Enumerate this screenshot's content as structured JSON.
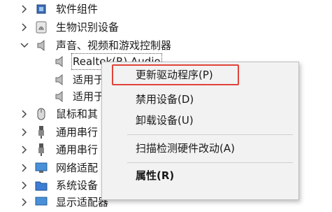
{
  "tree": [
    {
      "label": "软件组件",
      "icon": "chip-icon",
      "expanded": false
    },
    {
      "label": "生物识别设备",
      "icon": "fingerprint-icon",
      "expanded": false
    },
    {
      "label": "声音、视频和游戏控制器",
      "icon": "speaker-icon",
      "expanded": true
    },
    {
      "label": "Realtek(R) Audio",
      "icon": "speaker-icon",
      "child": true,
      "selected": true
    },
    {
      "label": "适用于",
      "icon": "speaker-icon",
      "child": true
    },
    {
      "label": "适用于",
      "icon": "speaker-icon",
      "child": true
    },
    {
      "label": "鼠标和其",
      "icon": "mouse-icon",
      "expanded": false
    },
    {
      "label": "通用串行",
      "icon": "usb-icon",
      "expanded": false
    },
    {
      "label": "通用串行",
      "icon": "usb-icon",
      "expanded": false
    },
    {
      "label": "网络适配",
      "icon": "monitor-network-icon",
      "expanded": false
    },
    {
      "label": "系统设备",
      "icon": "folder-icon",
      "expanded": false
    },
    {
      "label": "显示适配器",
      "icon": "monitor-icon",
      "expanded": false
    }
  ],
  "context_menu": {
    "items": [
      {
        "label": "更新驱动程序(P)",
        "bold": false
      },
      {
        "label": "禁用设备(D)",
        "bold": false
      },
      {
        "label": "卸载设备(U)",
        "bold": false
      },
      {
        "label": "扫描检测硬件改动(A)",
        "bold": false
      },
      {
        "label": "属性(R)",
        "bold": true
      }
    ]
  },
  "colors": {
    "highlight_border": "#e0443a",
    "menu_bg": "#f2f2f2"
  }
}
